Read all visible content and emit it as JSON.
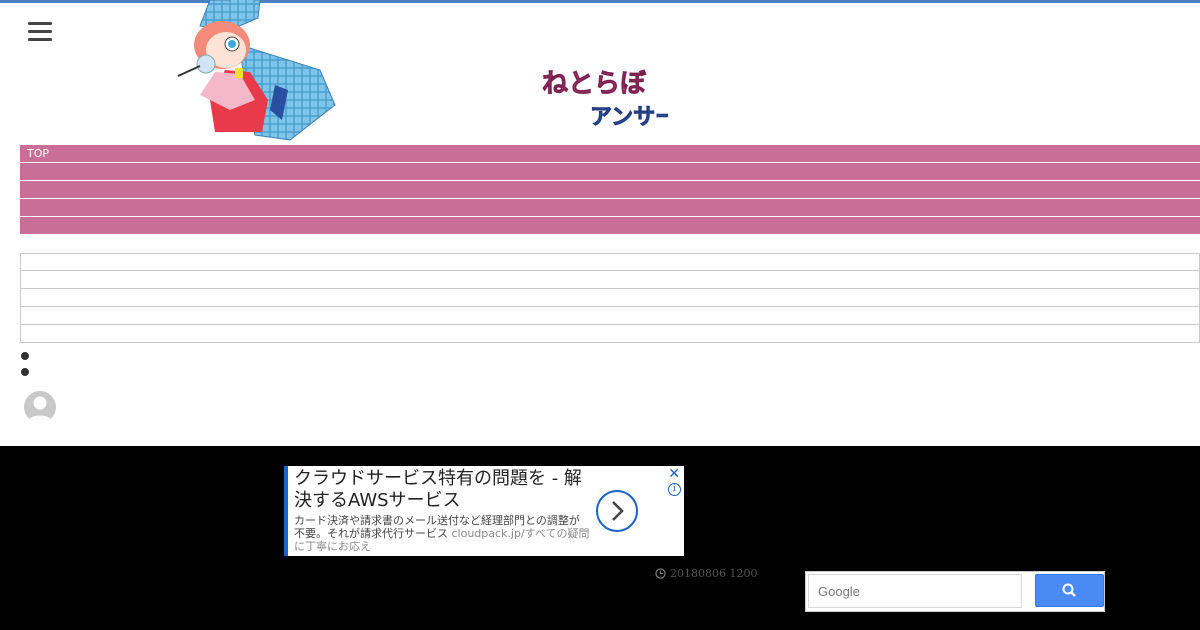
{
  "header": {
    "menu_icon": "hamburger-menu-icon",
    "logo_text_line1": "ねとらぼ",
    "logo_text_line2": "アンサー"
  },
  "nav": {
    "items": [
      {
        "label": "TOP"
      },
      {
        "label": ""
      },
      {
        "label": ""
      },
      {
        "label": ""
      },
      {
        "label": ""
      }
    ],
    "color": "#c86e97"
  },
  "list": {
    "rows": [
      "",
      "",
      "",
      "",
      ""
    ]
  },
  "footer": {
    "ad": {
      "title": "クラウドサービス特有の問題を - 解決するAWSサービス",
      "description": "カード決済や請求書のメール送付など経理部門との調整が不要。それが請求代行サービス",
      "url": "cloudpack.jp/すべての疑問に丁寧にお応え",
      "close_label": "✕",
      "info_label": "i",
      "accent": "#1b63c4"
    },
    "date": "20180806 1200",
    "search": {
      "placeholder": "Google",
      "button_icon": "search-icon",
      "button_color": "#4a8af4"
    }
  }
}
